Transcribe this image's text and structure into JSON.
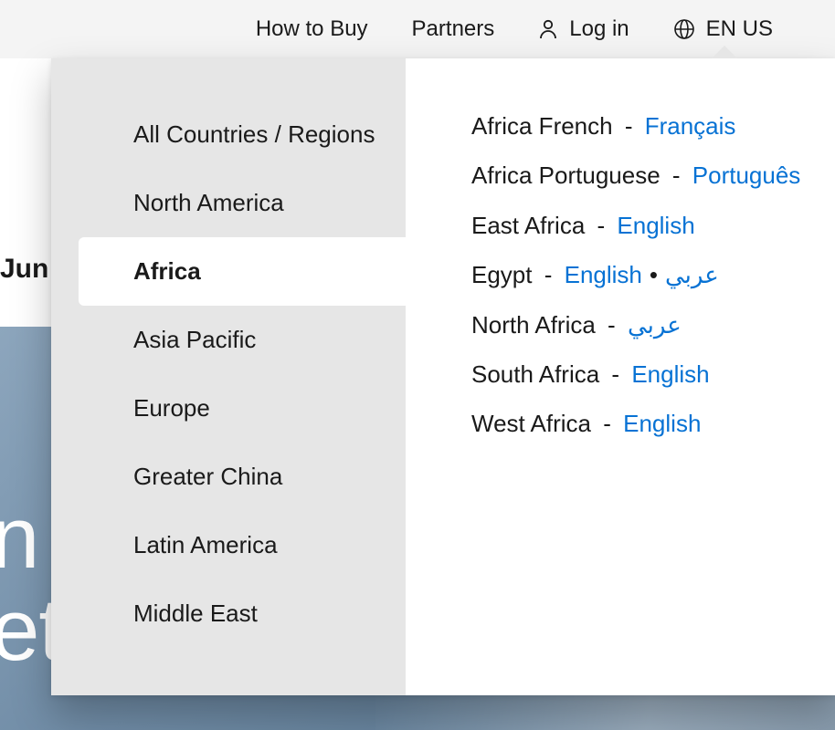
{
  "topbar": {
    "how_to_buy": "How to Buy",
    "partners": "Partners",
    "login": "Log in",
    "locale": "EN US"
  },
  "truncated": {
    "jun": "Jun",
    "hero_line1": "n",
    "hero_line2": "et"
  },
  "regions": [
    {
      "label": "All Countries / Regions",
      "active": false
    },
    {
      "label": "North America",
      "active": false
    },
    {
      "label": "Africa",
      "active": true
    },
    {
      "label": "Asia Pacific",
      "active": false
    },
    {
      "label": "Europe",
      "active": false
    },
    {
      "label": "Greater China",
      "active": false
    },
    {
      "label": "Latin America",
      "active": false
    },
    {
      "label": "Middle East",
      "active": false
    }
  ],
  "languages": [
    {
      "region": "Africa French",
      "langs": [
        "Français"
      ]
    },
    {
      "region": "Africa Portuguese",
      "langs": [
        "Português"
      ]
    },
    {
      "region": "East Africa",
      "langs": [
        "English"
      ]
    },
    {
      "region": "Egypt",
      "langs": [
        "English",
        "عربي"
      ]
    },
    {
      "region": "North Africa",
      "langs": [
        "عربي"
      ]
    },
    {
      "region": "South Africa",
      "langs": [
        "English"
      ]
    },
    {
      "region": "West Africa",
      "langs": [
        "English"
      ]
    }
  ]
}
